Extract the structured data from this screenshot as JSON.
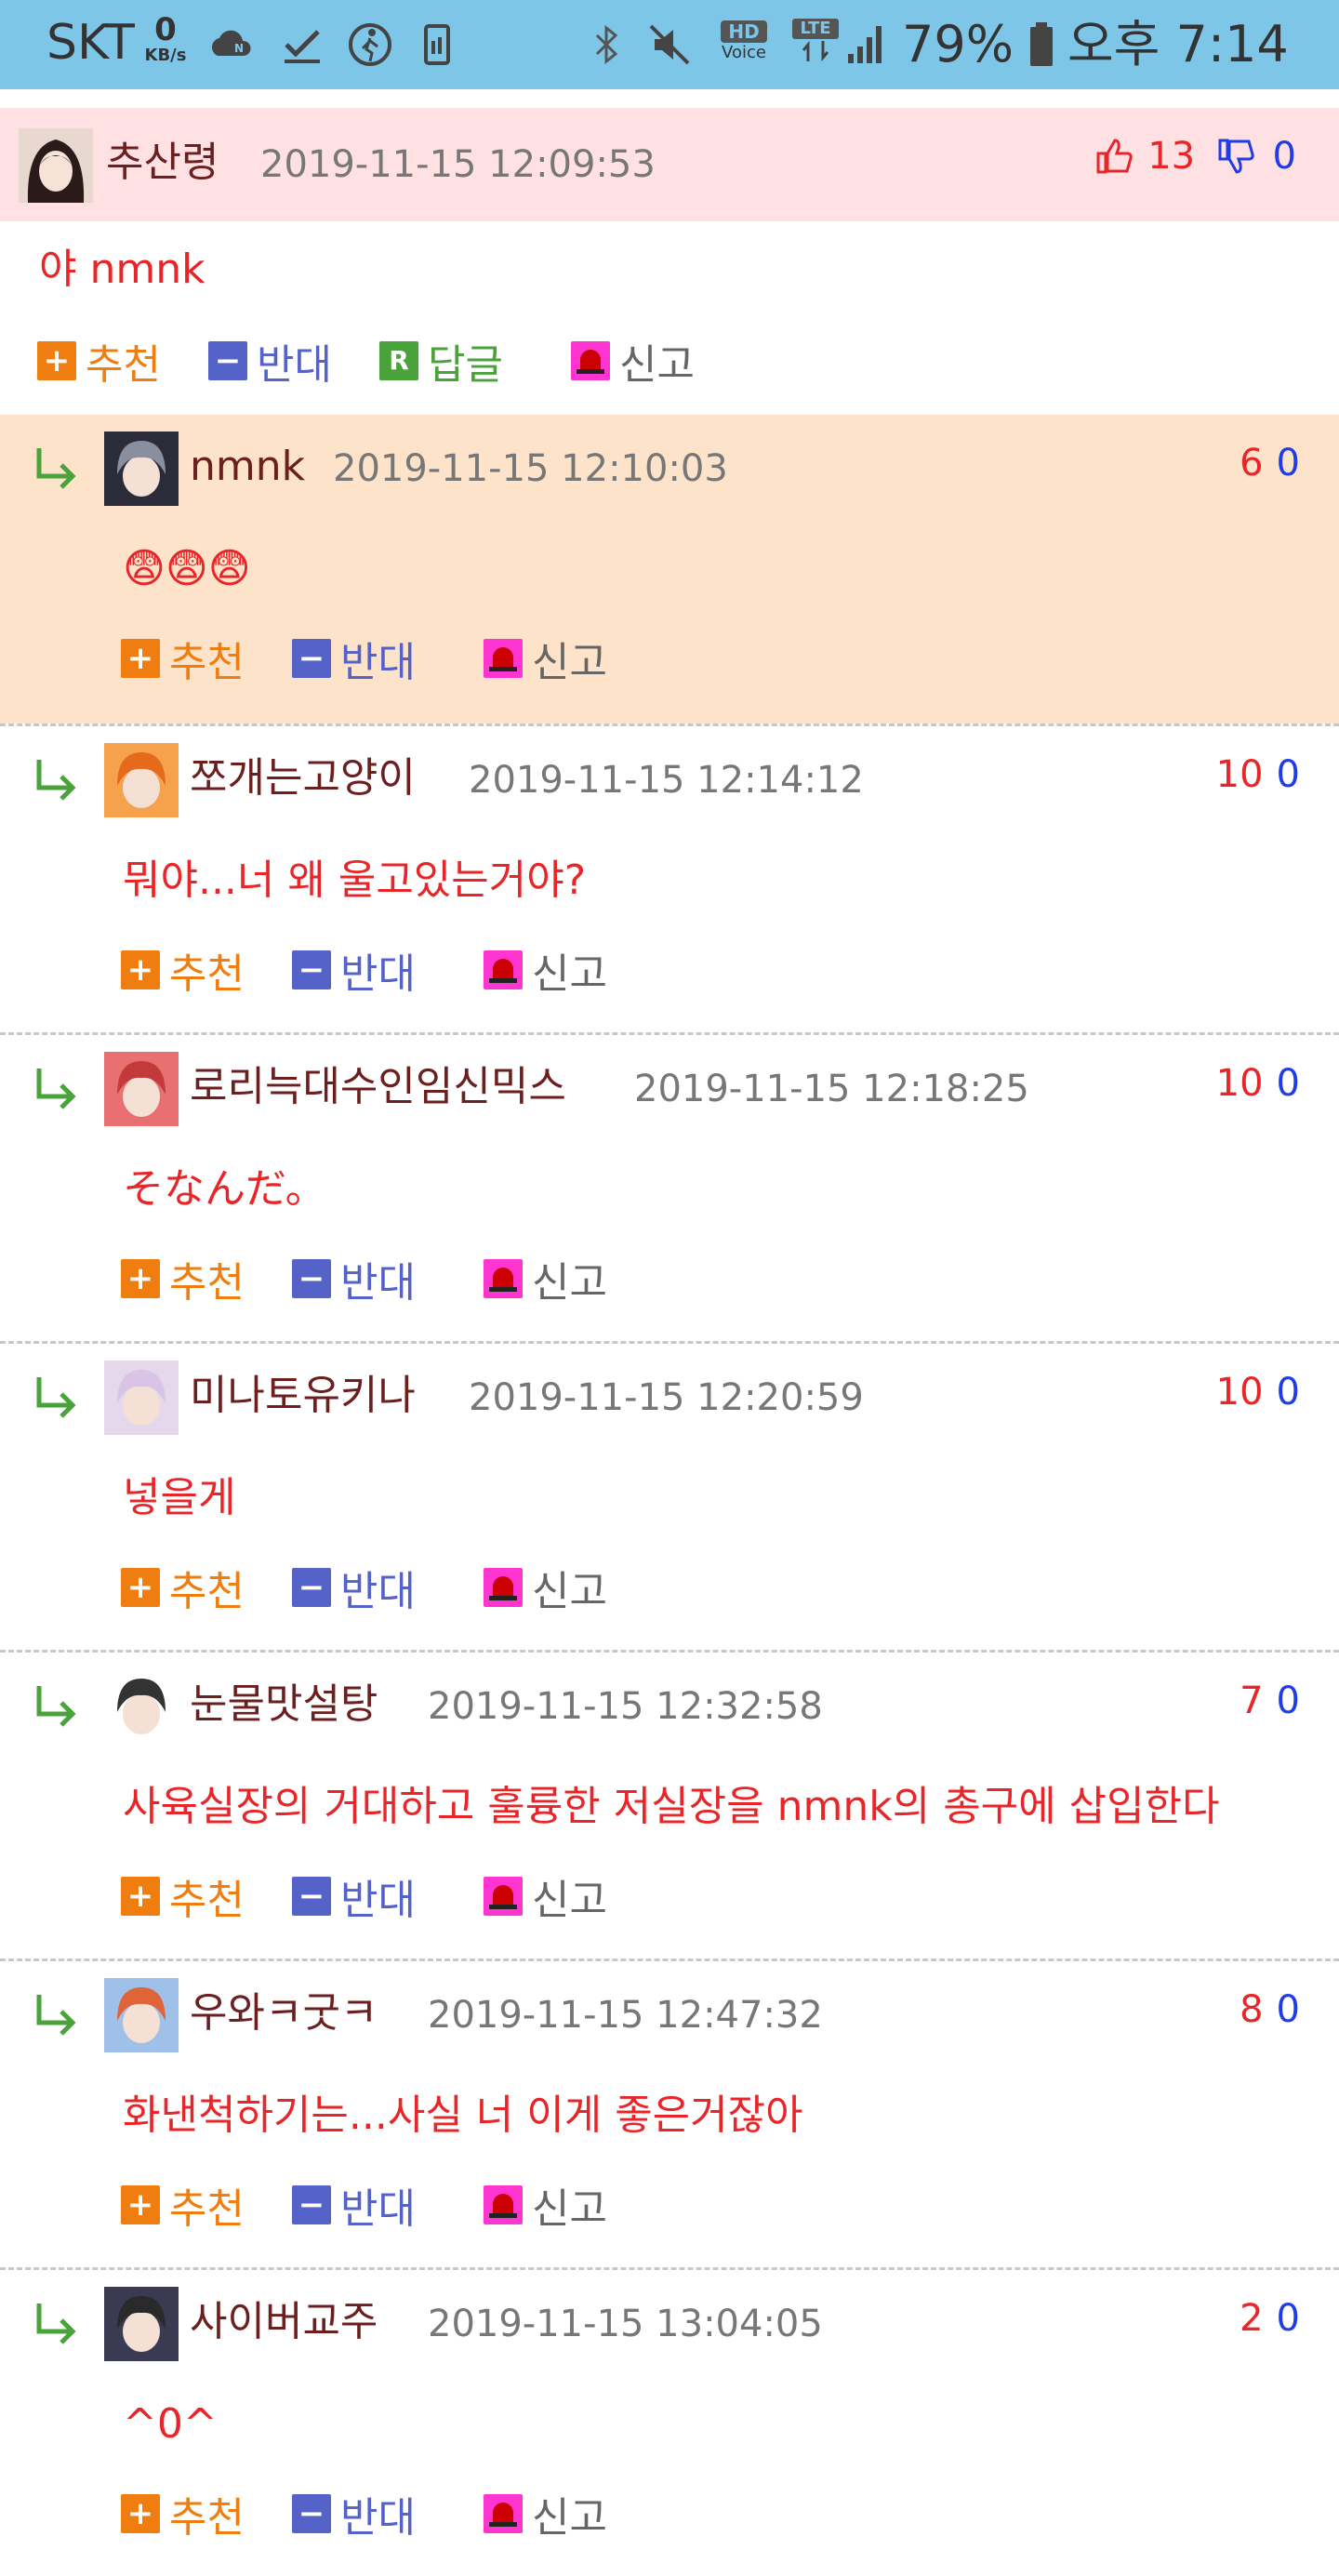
{
  "status_bar": {
    "carrier": "SKT",
    "net_speed": "0",
    "net_unit": "KB/s",
    "hd": "HD",
    "voice": "Voice",
    "lte": "LTE",
    "battery": "79%",
    "time": "오후 7:14",
    "icons": [
      "cloud-icon",
      "check-icon",
      "walking-icon",
      "phone-data-icon",
      "bluetooth-icon",
      "mute-icon",
      "hd-voice-icon",
      "lte-icon",
      "signal-icon",
      "battery-icon"
    ]
  },
  "colors": {
    "status_bar_bg": "#7ec6e8",
    "top_comment_bg": "#ffe1e3",
    "highlight_reply_bg": "#fde3c9",
    "recommend": "#f07d10",
    "oppose": "#5563c9",
    "reply": "#4aa33a",
    "report": "#ff35d2",
    "body_text": "#e8262a",
    "up_votes": "#e8262a",
    "down_votes": "#1f3ce8"
  },
  "actions": {
    "recommend": "추천",
    "oppose": "반대",
    "reply": "답글",
    "report": "신고",
    "reply_icon_letter": "R"
  },
  "top_comment": {
    "nick": "추산령",
    "date": "2019-11-15 12:09:53",
    "text": "야 nmnk",
    "up": "13",
    "down": "0"
  },
  "replies": [
    {
      "nick": "nmnk",
      "date": "2019-11-15 12:10:03",
      "text": "😨😨😨",
      "up": "6",
      "down": "0"
    },
    {
      "nick": "쪼개는고양이",
      "date": "2019-11-15 12:14:12",
      "text": "뭐야...너 왜 울고있는거야?",
      "up": "10",
      "down": "0"
    },
    {
      "nick": "로리늑대수인임신믹스",
      "date": "2019-11-15 12:18:25",
      "text": "そなんだ。",
      "up": "10",
      "down": "0"
    },
    {
      "nick": "미나토유키나",
      "date": "2019-11-15 12:20:59",
      "text": "넣을게",
      "up": "10",
      "down": "0"
    },
    {
      "nick": "눈물맛설탕",
      "date": "2019-11-15 12:32:58",
      "text": "사육실장의 거대하고 훌륭한 저실장을 nmnk의 총구에 삽입한다",
      "up": "7",
      "down": "0"
    },
    {
      "nick": "우와ㅋ굿ㅋ",
      "date": "2019-11-15 12:47:32",
      "text": "화낸척하기는...사실 너 이게 좋은거잖아",
      "up": "8",
      "down": "0"
    },
    {
      "nick": "사이버교주",
      "date": "2019-11-15 13:04:05",
      "text": "^0^",
      "up": "2",
      "down": "0"
    }
  ]
}
